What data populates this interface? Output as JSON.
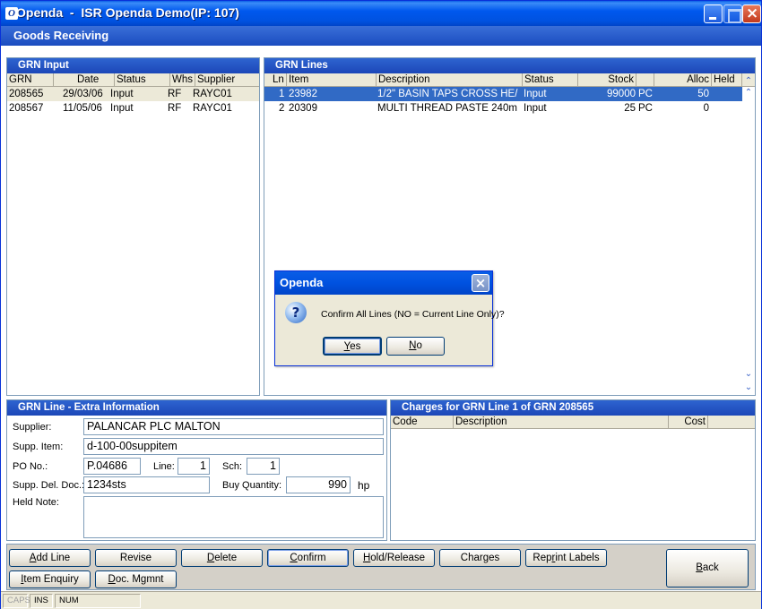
{
  "window": {
    "title": "Openda  -  ISR Openda Demo(IP: 107)",
    "icon_letter": "O"
  },
  "header": {
    "title": "Goods Receiving"
  },
  "grn_input": {
    "title": "GRN Input",
    "columns": [
      "GRN",
      "Date",
      "Status",
      "Whs",
      "Supplier"
    ],
    "rows": [
      {
        "grn": "208565",
        "date": "29/03/06",
        "status": "Input",
        "whs": "RF",
        "supplier": "RAYC01"
      },
      {
        "grn": "208567",
        "date": "11/05/06",
        "status": "Input",
        "whs": "RF",
        "supplier": "RAYC01"
      }
    ]
  },
  "grn_lines": {
    "title": "GRN Lines",
    "columns": [
      "Ln",
      "Item",
      "Description",
      "Status",
      "Stock",
      "",
      "Alloc",
      "Held"
    ],
    "rows": [
      {
        "ln": "1",
        "item": "23982",
        "description": "1/2\" BASIN TAPS CROSS HE/",
        "status": "Input",
        "stock": "99000",
        "uom": "PC",
        "alloc": "50"
      },
      {
        "ln": "2",
        "item": "20309",
        "description": "MULTI THREAD PASTE 240m",
        "status": "Input",
        "stock": "25",
        "uom": "PC",
        "alloc": "0"
      }
    ]
  },
  "extra_info": {
    "title": "GRN Line - Extra Information",
    "supplier_label": "Supplier:",
    "supplier_value": "PALANCAR PLC MALTON",
    "supp_item_label": "Supp. Item:",
    "supp_item_value": "d-100-00suppitem",
    "po_label": "PO No.:",
    "po_value": "P.04686",
    "line_label": "Line:",
    "line_value": "1",
    "sch_label": "Sch:",
    "sch_value": "1",
    "del_doc_label": "Supp. Del. Doc.:",
    "del_doc_value": "1234sts",
    "buy_qty_label": "Buy Quantity:",
    "buy_qty_value": "990",
    "buy_qty_unit": "hp",
    "held_note_label": "Held Note:"
  },
  "charges": {
    "title": "Charges for GRN Line 1 of GRN 208565",
    "columns": [
      "Code",
      "Description",
      "Cost"
    ]
  },
  "buttons": {
    "add_line": [
      "A",
      "dd Line"
    ],
    "revise": [
      "",
      "Revise"
    ],
    "delete": [
      "D",
      "elete"
    ],
    "confirm": [
      "C",
      "onfirm"
    ],
    "hold_release": [
      "H",
      "old/Release"
    ],
    "charges": [
      "",
      "Charges"
    ],
    "reprint_labels": [
      "Rep",
      "r",
      "int Labels"
    ],
    "item_enquiry": [
      "I",
      "tem Enquiry"
    ],
    "doc_mgmnt": [
      "D",
      "oc. Mgmnt"
    ],
    "back": [
      "B",
      "ack"
    ]
  },
  "status": {
    "caps": "CAPS",
    "ins": "INS",
    "num": "NUM"
  },
  "dialog": {
    "title": "Openda",
    "message": "Confirm All Lines (NO = Current Line Only)?",
    "yes": [
      "Y",
      "es"
    ],
    "no": [
      "N",
      "o"
    ]
  },
  "colors": {
    "title_blue": "#0058ee",
    "selection_blue": "#316ac5",
    "selection_beige": "#ece9d8",
    "panel_border": "#7f9db9"
  }
}
